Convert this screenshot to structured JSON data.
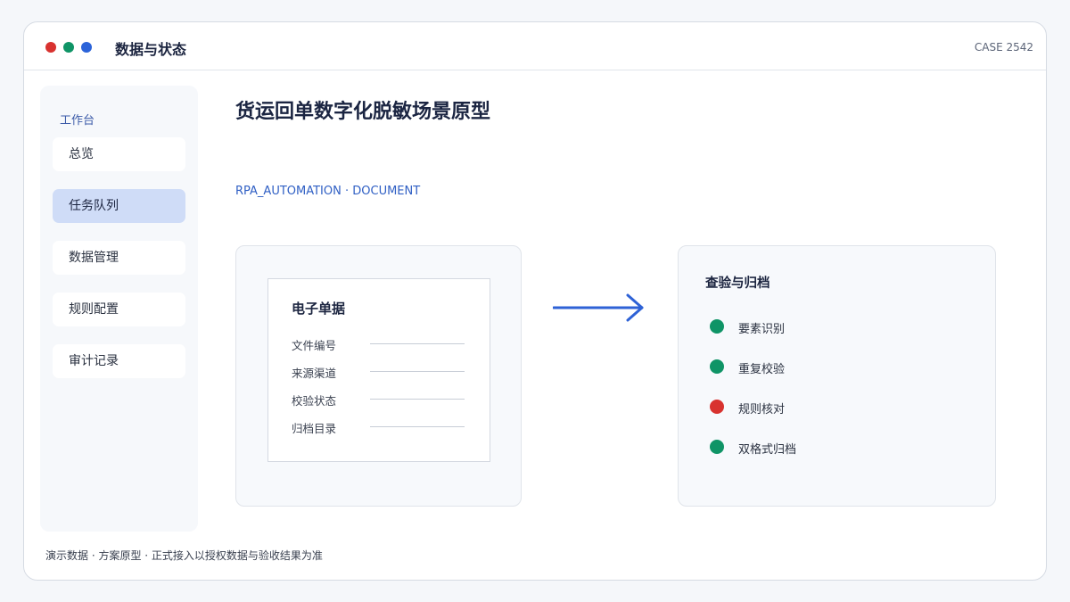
{
  "window": {
    "title": "数据与状态",
    "case_id": "CASE 2542",
    "traffic_lights": {
      "red": "#d8322f",
      "green": "#0f9466",
      "blue": "#2b63d9"
    }
  },
  "sidebar": {
    "heading": "工作台",
    "items": [
      {
        "label": "总览",
        "active": false
      },
      {
        "label": "任务队列",
        "active": true
      },
      {
        "label": "数据管理",
        "active": false
      },
      {
        "label": "规则配置",
        "active": false
      },
      {
        "label": "审计记录",
        "active": false
      }
    ]
  },
  "main": {
    "title": "货运回单数字化脱敏场景原型",
    "subtitle": "RPA_AUTOMATION · DOCUMENT",
    "document_card": {
      "title": "电子单据",
      "fields": [
        "文件编号",
        "来源渠道",
        "校验状态",
        "归档目录"
      ]
    },
    "arrow_icon": "arrow-right-icon",
    "arrow_color": "#2e62d6",
    "check_card": {
      "title": "查验与归档",
      "items": [
        {
          "label": "要素识别",
          "status_color": "#0f9466"
        },
        {
          "label": "重复校验",
          "status_color": "#0f9466"
        },
        {
          "label": "规则核对",
          "status_color": "#d8322f"
        },
        {
          "label": "双格式归档",
          "status_color": "#0f9466"
        }
      ]
    }
  },
  "footer": {
    "note": "演示数据 · 方案原型 · 正式接入以授权数据与验收结果为准"
  }
}
